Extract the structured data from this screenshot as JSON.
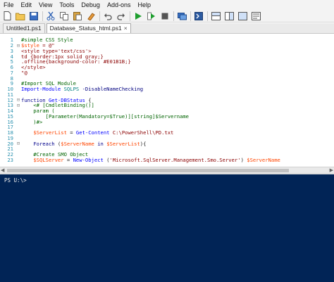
{
  "menu": [
    "File",
    "Edit",
    "View",
    "Tools",
    "Debug",
    "Add-ons",
    "Help"
  ],
  "toolbar": {
    "icons": [
      "new-file",
      "open",
      "save",
      "cut",
      "copy",
      "paste",
      "clear",
      "undo",
      "redo",
      "run",
      "run-selection",
      "stop",
      "new-remote-tab",
      "start-powershell",
      "show-script-pane-top",
      "show-script-pane-right",
      "show-script-pane-maximized",
      "show-command-addon"
    ]
  },
  "tabs": [
    {
      "label": "Untitled1.ps1",
      "active": false
    },
    {
      "label": "Database_Status_html.ps1",
      "active": true,
      "close": "×"
    }
  ],
  "editor": {
    "lines": [
      {
        "n": "1",
        "fold": "",
        "segs": [
          {
            "t": "#simple CSS Style",
            "c": "k-comment"
          }
        ]
      },
      {
        "n": "2",
        "fold": "⊟",
        "segs": [
          {
            "t": "$style",
            "c": "k-var"
          },
          {
            "t": " = @\"",
            "c": "k-str"
          }
        ]
      },
      {
        "n": "3",
        "fold": "",
        "segs": [
          {
            "t": "<style type='text/css'>",
            "c": "k-str"
          }
        ]
      },
      {
        "n": "4",
        "fold": "",
        "segs": [
          {
            "t": "td {border:1px solid gray;}",
            "c": "k-str"
          }
        ]
      },
      {
        "n": "5",
        "fold": "",
        "segs": [
          {
            "t": ".offline{background-color: #E01B1B;}",
            "c": "k-str"
          }
        ]
      },
      {
        "n": "6",
        "fold": "",
        "segs": [
          {
            "t": "</style>",
            "c": "k-str"
          }
        ]
      },
      {
        "n": "7",
        "fold": "",
        "segs": [
          {
            "t": "\"@",
            "c": "k-str"
          }
        ]
      },
      {
        "n": "8",
        "fold": "",
        "segs": [
          {
            "t": "",
            "c": "code"
          }
        ]
      },
      {
        "n": "9",
        "fold": "",
        "segs": [
          {
            "t": "#Import SQL Module",
            "c": "k-comment"
          }
        ]
      },
      {
        "n": "10",
        "fold": "",
        "segs": [
          {
            "t": "Import-Module",
            "c": "k-cmd"
          },
          {
            "t": " SQLPS ",
            "c": "k-type"
          },
          {
            "t": "-DisableNameChecking",
            "c": "k-param"
          }
        ]
      },
      {
        "n": "11",
        "fold": "",
        "segs": [
          {
            "t": "",
            "c": "code"
          }
        ]
      },
      {
        "n": "12",
        "fold": "⊟",
        "segs": [
          {
            "t": "function",
            "c": "k-kw"
          },
          {
            "t": " Get-DBStatus",
            "c": "k-cmd"
          },
          {
            "t": " {",
            "c": "code"
          }
        ]
      },
      {
        "n": "13",
        "fold": "⊟",
        "segs": [
          {
            "t": "    <# [CmdletBinding()]",
            "c": "k-comment"
          }
        ]
      },
      {
        "n": "14",
        "fold": "",
        "segs": [
          {
            "t": "    param (",
            "c": "k-comment"
          }
        ]
      },
      {
        "n": "15",
        "fold": "",
        "segs": [
          {
            "t": "        [Parameter(Mandatory=$True)][string]$Servername",
            "c": "k-comment"
          }
        ]
      },
      {
        "n": "16",
        "fold": "",
        "segs": [
          {
            "t": "    )#>",
            "c": "k-comment"
          }
        ]
      },
      {
        "n": "17",
        "fold": "",
        "segs": [
          {
            "t": "",
            "c": "code"
          }
        ]
      },
      {
        "n": "18",
        "fold": "",
        "segs": [
          {
            "t": "    ",
            "c": "code"
          },
          {
            "t": "$ServerList",
            "c": "k-var"
          },
          {
            "t": " = ",
            "c": "code"
          },
          {
            "t": "Get-Content",
            "c": "k-cmd"
          },
          {
            "t": " C:\\PowerShell\\PD.txt",
            "c": "k-str"
          }
        ]
      },
      {
        "n": "19",
        "fold": "",
        "segs": [
          {
            "t": "",
            "c": "code"
          }
        ]
      },
      {
        "n": "20",
        "fold": "⊟",
        "segs": [
          {
            "t": "    ",
            "c": "code"
          },
          {
            "t": "Foreach",
            "c": "k-kw"
          },
          {
            "t": " (",
            "c": "code"
          },
          {
            "t": "$ServerName",
            "c": "k-var"
          },
          {
            "t": " in ",
            "c": "k-kw"
          },
          {
            "t": "$ServerList",
            "c": "k-var"
          },
          {
            "t": "){",
            "c": "code"
          }
        ]
      },
      {
        "n": "21",
        "fold": "",
        "segs": [
          {
            "t": "",
            "c": "code"
          }
        ]
      },
      {
        "n": "22",
        "fold": "",
        "segs": [
          {
            "t": "    #Create SMO Object",
            "c": "k-comment"
          }
        ]
      },
      {
        "n": "23",
        "fold": "",
        "segs": [
          {
            "t": "    ",
            "c": "code"
          },
          {
            "t": "$SQLServer",
            "c": "k-var"
          },
          {
            "t": " = ",
            "c": "code"
          },
          {
            "t": "New-Object",
            "c": "k-cmd"
          },
          {
            "t": " (",
            "c": "code"
          },
          {
            "t": "'Microsoft.SqlServer.Management.Smo.Server'",
            "c": "k-str"
          },
          {
            "t": ") ",
            "c": "code"
          },
          {
            "t": "$ServerName",
            "c": "k-var"
          }
        ]
      }
    ]
  },
  "console": {
    "prompt": "PS U:\\>"
  }
}
